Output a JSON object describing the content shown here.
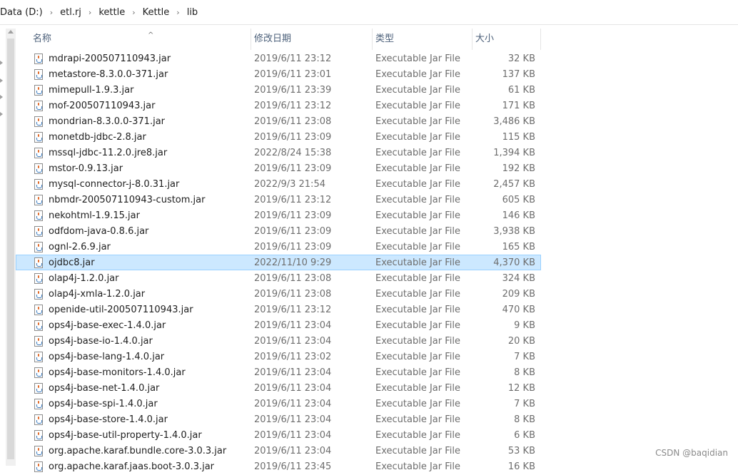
{
  "breadcrumb": [
    "Data (D:)",
    "etl.rj",
    "kettle",
    "Kettle",
    "lib"
  ],
  "columns": {
    "name": "名称",
    "date": "修改日期",
    "type": "类型",
    "size": "大小"
  },
  "sort_indicator": "^",
  "selected_file": "ojdbc8.jar",
  "files": [
    {
      "name": "mdrapi-200507110943.jar",
      "date": "2019/6/11 23:12",
      "type": "Executable Jar File",
      "size": "32 KB"
    },
    {
      "name": "metastore-8.3.0.0-371.jar",
      "date": "2019/6/11 23:01",
      "type": "Executable Jar File",
      "size": "137 KB"
    },
    {
      "name": "mimepull-1.9.3.jar",
      "date": "2019/6/11 23:39",
      "type": "Executable Jar File",
      "size": "61 KB"
    },
    {
      "name": "mof-200507110943.jar",
      "date": "2019/6/11 23:12",
      "type": "Executable Jar File",
      "size": "171 KB"
    },
    {
      "name": "mondrian-8.3.0.0-371.jar",
      "date": "2019/6/11 23:08",
      "type": "Executable Jar File",
      "size": "3,486 KB"
    },
    {
      "name": "monetdb-jdbc-2.8.jar",
      "date": "2019/6/11 23:09",
      "type": "Executable Jar File",
      "size": "115 KB"
    },
    {
      "name": "mssql-jdbc-11.2.0.jre8.jar",
      "date": "2022/8/24 15:38",
      "type": "Executable Jar File",
      "size": "1,394 KB"
    },
    {
      "name": "mstor-0.9.13.jar",
      "date": "2019/6/11 23:09",
      "type": "Executable Jar File",
      "size": "192 KB"
    },
    {
      "name": "mysql-connector-j-8.0.31.jar",
      "date": "2022/9/3 21:54",
      "type": "Executable Jar File",
      "size": "2,457 KB"
    },
    {
      "name": "nbmdr-200507110943-custom.jar",
      "date": "2019/6/11 23:12",
      "type": "Executable Jar File",
      "size": "605 KB"
    },
    {
      "name": "nekohtml-1.9.15.jar",
      "date": "2019/6/11 23:09",
      "type": "Executable Jar File",
      "size": "146 KB"
    },
    {
      "name": "odfdom-java-0.8.6.jar",
      "date": "2019/6/11 23:09",
      "type": "Executable Jar File",
      "size": "3,938 KB"
    },
    {
      "name": "ognl-2.6.9.jar",
      "date": "2019/6/11 23:09",
      "type": "Executable Jar File",
      "size": "165 KB"
    },
    {
      "name": "ojdbc8.jar",
      "date": "2022/11/10 9:29",
      "type": "Executable Jar File",
      "size": "4,370 KB"
    },
    {
      "name": "olap4j-1.2.0.jar",
      "date": "2019/6/11 23:08",
      "type": "Executable Jar File",
      "size": "324 KB"
    },
    {
      "name": "olap4j-xmla-1.2.0.jar",
      "date": "2019/6/11 23:08",
      "type": "Executable Jar File",
      "size": "209 KB"
    },
    {
      "name": "openide-util-200507110943.jar",
      "date": "2019/6/11 23:12",
      "type": "Executable Jar File",
      "size": "470 KB"
    },
    {
      "name": "ops4j-base-exec-1.4.0.jar",
      "date": "2019/6/11 23:04",
      "type": "Executable Jar File",
      "size": "9 KB"
    },
    {
      "name": "ops4j-base-io-1.4.0.jar",
      "date": "2019/6/11 23:04",
      "type": "Executable Jar File",
      "size": "20 KB"
    },
    {
      "name": "ops4j-base-lang-1.4.0.jar",
      "date": "2019/6/11 23:02",
      "type": "Executable Jar File",
      "size": "7 KB"
    },
    {
      "name": "ops4j-base-monitors-1.4.0.jar",
      "date": "2019/6/11 23:04",
      "type": "Executable Jar File",
      "size": "8 KB"
    },
    {
      "name": "ops4j-base-net-1.4.0.jar",
      "date": "2019/6/11 23:04",
      "type": "Executable Jar File",
      "size": "12 KB"
    },
    {
      "name": "ops4j-base-spi-1.4.0.jar",
      "date": "2019/6/11 23:04",
      "type": "Executable Jar File",
      "size": "7 KB"
    },
    {
      "name": "ops4j-base-store-1.4.0.jar",
      "date": "2019/6/11 23:04",
      "type": "Executable Jar File",
      "size": "8 KB"
    },
    {
      "name": "ops4j-base-util-property-1.4.0.jar",
      "date": "2019/6/11 23:04",
      "type": "Executable Jar File",
      "size": "6 KB"
    },
    {
      "name": "org.apache.karaf.bundle.core-3.0.3.jar",
      "date": "2019/6/11 23:04",
      "type": "Executable Jar File",
      "size": "53 KB"
    },
    {
      "name": "org.apache.karaf.jaas.boot-3.0.3.jar",
      "date": "2019/6/11 23:45",
      "type": "Executable Jar File",
      "size": "16 KB"
    }
  ],
  "watermark": "CSDN @baqidian"
}
